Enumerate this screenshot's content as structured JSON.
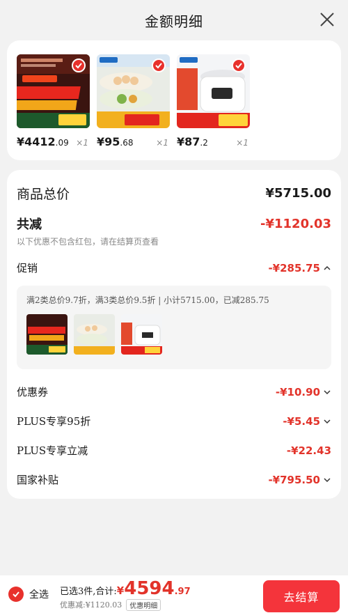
{
  "header": {
    "title": "金额明细",
    "close_icon": "close-icon"
  },
  "products": [
    {
      "price_int": "¥4412",
      "price_dec": ".09",
      "qty": "×1"
    },
    {
      "price_int": "¥95",
      "price_dec": ".68",
      "qty": "×1"
    },
    {
      "price_int": "¥87",
      "price_dec": ".2",
      "qty": "×1"
    }
  ],
  "summary": {
    "total_label": "商品总价",
    "total_value": "¥5715.00",
    "discount_label": "共减",
    "discount_value": "-¥1120.03",
    "discount_note": "以下优惠不包含红包，请在结算页查看"
  },
  "promo": {
    "label": "促销",
    "value": "-¥285.75",
    "detail": "满2类总价9.7折，满3类总价9.5折 | 小计5715.00，已减285.75"
  },
  "lines": [
    {
      "label": "优惠券",
      "value": "-¥10.90",
      "chevron": true
    },
    {
      "label": "PLUS专享95折",
      "value": "-¥5.45",
      "chevron": true
    },
    {
      "label": "PLUS专享立减",
      "value": "-¥22.43",
      "chevron": false
    },
    {
      "label": "国家补贴",
      "value": "-¥795.50",
      "chevron": true
    }
  ],
  "footer": {
    "select_all": "全选",
    "selected_text": "已选3件,合计:",
    "total_currency": "¥",
    "total_int": "4594",
    "total_dec": ".97",
    "discount_text": "优惠减:¥1120.03",
    "detail_tag": "优惠明细",
    "checkout": "去结算"
  },
  "colors": {
    "accent": "#e2332a",
    "checkout_bg": "#f4343b",
    "page_bg": "#f2f2f2"
  }
}
